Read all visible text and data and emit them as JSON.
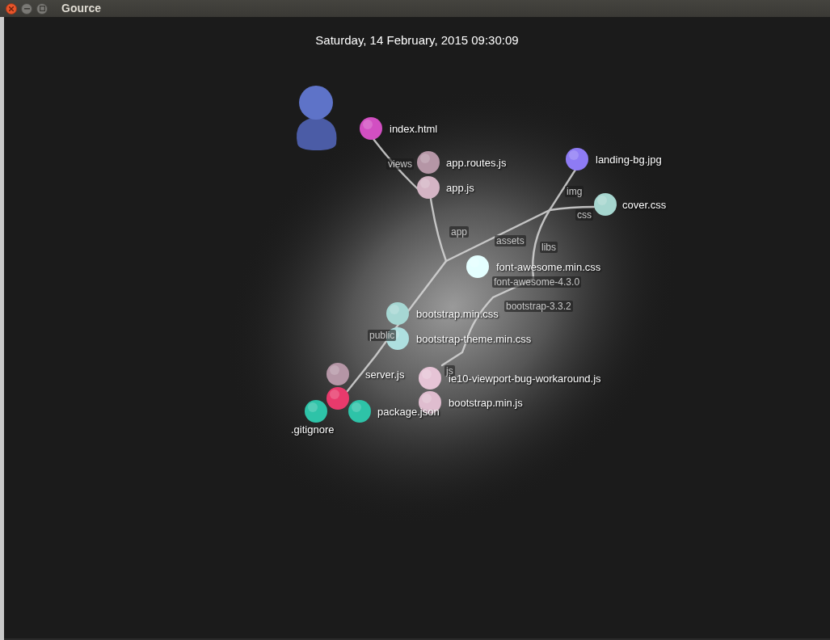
{
  "window": {
    "title": "Gource"
  },
  "date": "Saturday, 14 February, 2015 09:30:09",
  "files": [
    {
      "name": "index.html",
      "color": "#d24fc2"
    },
    {
      "name": "app.routes.js",
      "color": "#b596a6"
    },
    {
      "name": "app.js",
      "color": "#d4b4c4"
    },
    {
      "name": "landing-bg.jpg",
      "color": "#8e7bf4"
    },
    {
      "name": "cover.css",
      "color": "#a6d6cf"
    },
    {
      "name": "font-awesome.min.css",
      "color": "#e4ffff"
    },
    {
      "name": "bootstrap.min.css",
      "color": "#a6d7d3"
    },
    {
      "name": "bootstrap-theme.min.css",
      "color": "#aedfdf"
    },
    {
      "name": "server.js",
      "color": "#b596a6"
    },
    {
      "name": "ie10-viewport-bug-workaround.js",
      "color": "#e6c4d6"
    },
    {
      "name": "bootstrap.min.js",
      "color": "#dfbdcf"
    },
    {
      "color": "#e83a6c"
    },
    {
      "name": ".gitignore",
      "color": "#2ec3a8"
    },
    {
      "name": "package.json",
      "color": "#2ec3a8"
    }
  ],
  "directories": [
    {
      "name": "views"
    },
    {
      "name": "app"
    },
    {
      "name": "img"
    },
    {
      "name": "css"
    },
    {
      "name": "assets"
    },
    {
      "name": "libs"
    },
    {
      "name": "font-awesome-4.3.0"
    },
    {
      "name": "bootstrap-3.3.2"
    },
    {
      "name": "public"
    },
    {
      "name": "js"
    }
  ]
}
